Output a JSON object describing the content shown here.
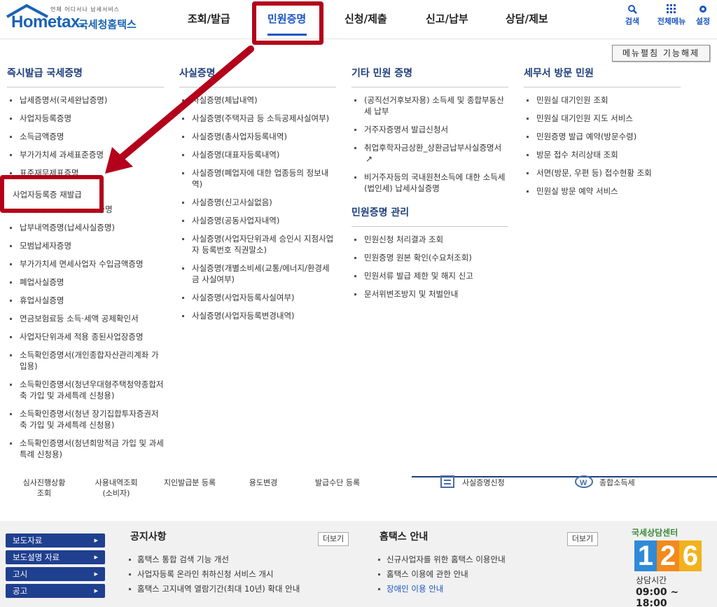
{
  "header": {
    "logo_brand": "Hometax.",
    "logo_tag": "언제 어디서나 납세서비스",
    "logo_sub": "국세청홈택스",
    "nav": [
      "조회/발급",
      "민원증명",
      "신청/제출",
      "신고/납부",
      "상담/제보"
    ],
    "tools": {
      "search": "검색",
      "menu": "전체메뉴",
      "settings": "설정"
    }
  },
  "mega": {
    "collapse_label": "메뉴펼침 기능해제",
    "col1": {
      "title": "즉시발급 국세증명",
      "items": [
        "납세증명서(국세완납증명)",
        "사업자등록증명",
        "소득금액증명",
        "부가가치세 과세표준증명",
        "표준재무제표증명",
        "사업자등록증 재발급",
        "연도(사업)별 수입금액 증명",
        "납부내역증명(납세사실증명)",
        "모범납세자증명",
        "부가가치세 면세사업자 수입금액증명",
        "폐업사실증명",
        "휴업사실증명",
        "연금보험료등 소득·세액 공제확인서",
        "사업자단위과세 적용 종된사업장증명",
        "소득확인증명서(개인종합자산관리계좌 가입용)",
        "소득확인증명서(청년우대형주택청약종합저축 가입 및 과세특례 신청용)",
        "소득확인증명서(청년 장기집합투자증권저축 가입 및 과세특례 신청용)",
        "소득확인증명서(청년희망적금 가입 및 과세특례 신청용)"
      ]
    },
    "col2": {
      "title": "사실증명",
      "items": [
        "사실증명(체납내역)",
        "사실증명(주택자금 등 소득공제사실여부)",
        "사실증명(총사업자등록내역)",
        "사실증명(대표자등록내역)",
        "사실증명(폐업자에 대한 업종등의 정보내역)",
        "사실증명(신고사실없음)",
        "사실증명(공동사업자내역)",
        "사실증명(사업자단위과세 승인시 지점사업자 등록번호 직권말소)",
        "사실증명(개별소비세(교통/에너지/환경세금 사실여부)",
        "사실증명(사업자등록사실여부)",
        "사실증명(사업자등록변경내역)"
      ]
    },
    "col3": {
      "title": "기타 민원 증명",
      "items": [
        "(공직선거후보자용) 소득세 및 종합부동산세 납부",
        "거주자증명서 발급신청서",
        "취업후학자금상환_상환금납부사실증명서",
        "비거주자등의 국내원천소득에 대한 소득세(법인세) 납세사실증명"
      ],
      "title2": "민원증명 관리",
      "items2": [
        "민원신청 처리결과 조회",
        "민원증명 원본 확인(수요처조회)",
        "민원서류 발급 제한 및 해지 신고",
        "문서위변조방지 및 처벌안내"
      ]
    },
    "col4": {
      "title": "세무서 방문 민원",
      "items": [
        "민원실 대기인원 조회",
        "민원실 대기인원 지도 서비스",
        "민원증명 발급 예약(방문수령)",
        "방문 접수 처리상태 조회",
        "서면(방문, 우편 등) 접수현황 조회",
        "민원실 방문 예약 서비스"
      ]
    }
  },
  "strip": {
    "items": [
      "심사진행상황\n조회",
      "사용내역조회\n(소비자)",
      "지인발급분 등록",
      "용도변경",
      "발급수단 등록"
    ],
    "right_items": [
      "사실증명신청",
      "종합소득세"
    ]
  },
  "footer": {
    "side_buttons": [
      "보도자료",
      "보도설명 자료",
      "고시",
      "공고"
    ],
    "notice_title": "공지사항",
    "more": "더보기",
    "notices": [
      "홈택스 통합 검색 기능 개선",
      "사업자등록 온라인 취하신청 서비스 개시",
      "홈택스 고지내역 열람기간(최대 10년) 확대 안내"
    ],
    "guide_title": "홈택스 안내",
    "guides": [
      "신규사업자를 위한 홈택스 이용안내",
      "홈택스 이용에 관한 안내",
      "장애인 이용 안내"
    ],
    "center": {
      "name": "국세상담센터",
      "d1": "1",
      "d2": "2",
      "d3": "6",
      "hours_label": "상담시간",
      "hours": "09:00 ~ 18:00"
    }
  },
  "colors": {
    "accent": "#1a56c4",
    "navy": "#1f3f8f",
    "highlight": "#b3001b"
  }
}
